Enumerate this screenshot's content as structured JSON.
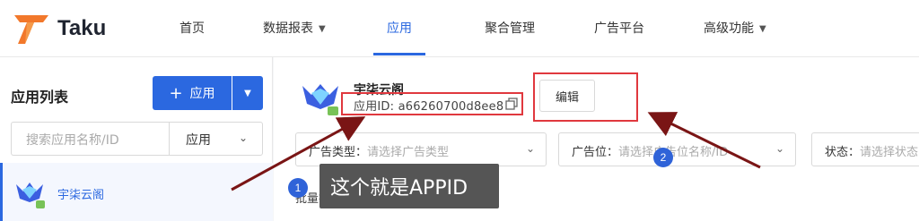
{
  "brand": {
    "name": "Taku"
  },
  "nav": {
    "items": [
      {
        "label": "首页"
      },
      {
        "label": "数据报表",
        "dropdown": true
      },
      {
        "label": "应用",
        "active": true
      },
      {
        "label": "聚合管理"
      },
      {
        "label": "广告平台"
      },
      {
        "label": "高级功能",
        "dropdown": true
      }
    ]
  },
  "sidebar": {
    "title": "应用列表",
    "add_button": "应用",
    "search_placeholder": "搜索应用名称/ID",
    "type_select": "应用",
    "apps": [
      {
        "name": "宇柒云阁",
        "platform": "android"
      }
    ]
  },
  "detail": {
    "app_name": "宇柒云阁",
    "app_id_label": "应用ID:",
    "app_id": "a66260700d8ee8",
    "edit_button": "编辑"
  },
  "filters": [
    {
      "label": "广告类型",
      "placeholder": "请选择广告类型"
    },
    {
      "label": "广告位",
      "placeholder": "请选择广告位名称/ID"
    },
    {
      "label": "状态",
      "placeholder": "请选择状态"
    }
  ],
  "batch_label": "批量操作",
  "annotations": {
    "badge1": "1",
    "badge2": "2",
    "tooltip": "这个就是APPID"
  },
  "colors": {
    "accent": "#2b68e0",
    "annotation_red": "#e0383e",
    "arrow": "#7a1515",
    "brand_orange": "#f2782b"
  }
}
